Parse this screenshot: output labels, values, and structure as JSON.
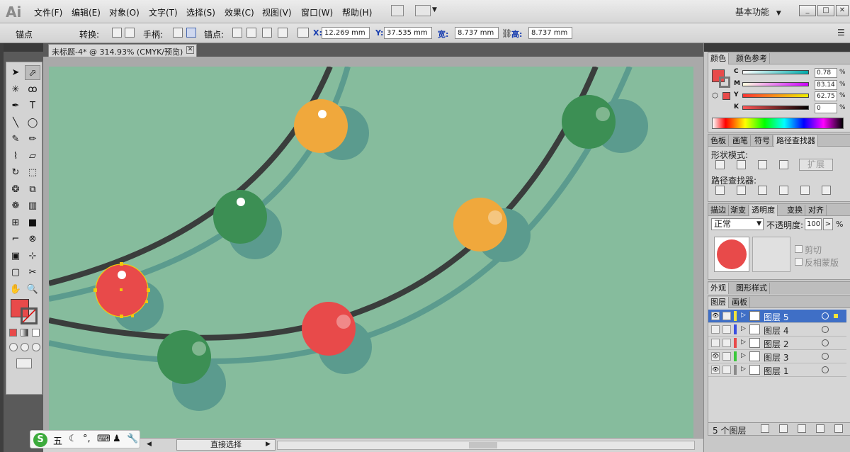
{
  "app": {
    "logo": "Ai",
    "menus": [
      "文件(F)",
      "编辑(E)",
      "对象(O)",
      "文字(T)",
      "选择(S)",
      "效果(C)",
      "视图(V)",
      "窗口(W)",
      "帮助(H)"
    ],
    "workspace": "基本功能",
    "workspace_arrow": "▼",
    "window_buttons": [
      "_",
      "□",
      "✕"
    ]
  },
  "control_bar": {
    "anchor_label": "锚点",
    "convert_label": "转换:",
    "handles_label": "手柄:",
    "anchors_label": "锚点:",
    "x_label": "X:",
    "x_value": "12.269 mm",
    "y_label": "Y:",
    "y_value": "37.535 mm",
    "w_label": "宽:",
    "w_value": "8.737 mm",
    "h_label": "高:",
    "h_value": "8.737 mm"
  },
  "document": {
    "tab_title": "未标题-4* @ 314.93% (CMYK/预览)",
    "close": "✕"
  },
  "tools": {
    "icons": [
      "selection-icon",
      "direct-selection-icon",
      "magic-wand-icon",
      "lasso-icon",
      "pen-icon",
      "type-icon",
      "line-icon",
      "ellipse-icon",
      "paintbrush-icon",
      "pencil-icon",
      "blob-brush-icon",
      "eraser-icon",
      "rotate-icon",
      "scale-icon",
      "warp-icon",
      "free-transform-icon",
      "symbol-sprayer-icon",
      "column-graph-icon",
      "mesh-icon",
      "gradient-icon",
      "eyedropper-icon",
      "blend-icon",
      "live-paint-icon",
      "live-paint-select-icon",
      "artboard-icon",
      "slice-icon",
      "hand-icon",
      "zoom-icon"
    ],
    "glyphs": [
      "➤",
      "⬀",
      "✳",
      "ꝏ",
      "✒",
      "T",
      "╲",
      "◯",
      "✎",
      "✏",
      "⌇",
      "▱",
      "↻",
      "⬚",
      "❂",
      "⧉",
      "❁",
      "▥",
      "⊞",
      "■",
      "⌐",
      "⊗",
      "▣",
      "⊹",
      "▢",
      "✂",
      "✋",
      "🔍"
    ],
    "fill_color": "#e84a4a",
    "stroke_color": "none"
  },
  "canvas": {
    "background": "#86bc9d",
    "wire_color": "#3a3d3c",
    "shadow_color": "#5b9b8e",
    "colors": {
      "red": "#e84a4a",
      "orange": "#f0a83c",
      "green": "#3c8f54",
      "selection": "#f2c90c"
    }
  },
  "status_bar": {
    "mode_label": "直接选择",
    "arrow": "▶",
    "left_arrow": "◀"
  },
  "ime": {
    "logo": "S",
    "items": [
      "五",
      "☾",
      "°,",
      "⌨",
      "♟",
      "🔧"
    ]
  },
  "color_panel": {
    "tabs": [
      "颜色",
      "颜色参考"
    ],
    "channels": [
      {
        "label": "C",
        "value": "0.78"
      },
      {
        "label": "M",
        "value": "83.14"
      },
      {
        "label": "Y",
        "value": "62.75"
      },
      {
        "label": "K",
        "value": "0"
      }
    ],
    "percent": "%",
    "fill_color": "#e84a4a"
  },
  "pathfinder_panel": {
    "tabs": [
      "色板",
      "画笔",
      "符号",
      "路径查找器"
    ],
    "shape_modes_label": "形状模式:",
    "expand_label": "扩展",
    "pathfinders_label": "路径查找器:"
  },
  "transparency_panel": {
    "tabs": [
      "描边",
      "渐变",
      "透明度",
      "变换",
      "对齐"
    ],
    "blend_mode": "正常",
    "opacity_label": "不透明度:",
    "opacity_value": "100",
    "opacity_unit": ">",
    "percent": "%",
    "clip_label": "剪切",
    "invert_mask_label": "反相蒙版",
    "thumb_color": "#e84a4a"
  },
  "appearance_panel": {
    "tabs": [
      "外观",
      "图形样式"
    ]
  },
  "layers_panel": {
    "tabs": [
      "图层",
      "画板"
    ],
    "layers": [
      {
        "name": "图层 5",
        "color": "#f2e43a",
        "selected": true
      },
      {
        "name": "图层 4",
        "color": "#3a4fe0",
        "selected": false
      },
      {
        "name": "图层 2",
        "color": "#e84a4a",
        "selected": false
      },
      {
        "name": "图层 3",
        "color": "#3cc83c",
        "selected": false
      },
      {
        "name": "图层 1",
        "color": "#8a8a8a",
        "selected": false
      }
    ],
    "count_label": "5 个图层"
  }
}
